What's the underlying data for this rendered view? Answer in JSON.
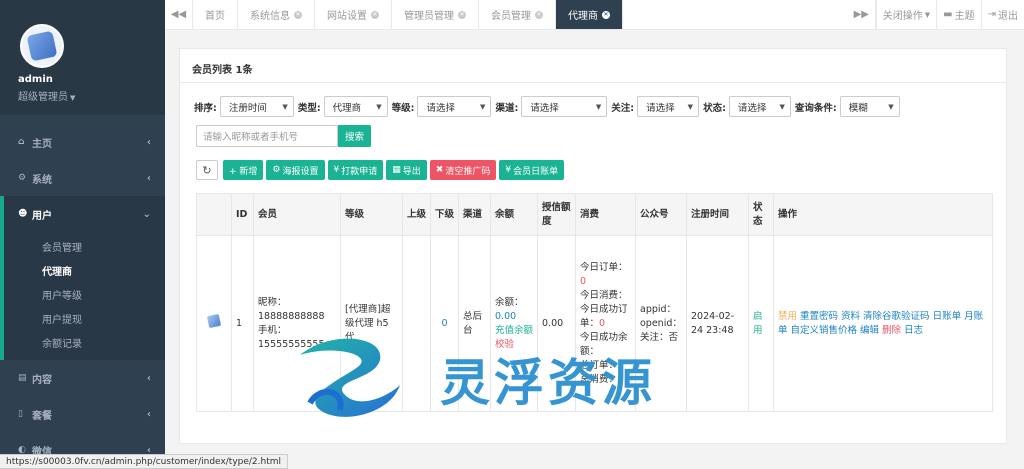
{
  "user": {
    "name": "admin",
    "role": "超级管理员"
  },
  "menu": [
    {
      "label": "主页",
      "icon": "home-icon"
    },
    {
      "label": "系统",
      "icon": "cogs-icon"
    },
    {
      "label": "用户",
      "icon": "users-icon"
    },
    {
      "label": "内容",
      "icon": "book-icon"
    },
    {
      "label": "套餐",
      "icon": "file-icon"
    },
    {
      "label": "微信",
      "icon": "wechat-icon"
    }
  ],
  "submenu": [
    "会员管理",
    "代理商",
    "用户等级",
    "用户提现",
    "余额记录"
  ],
  "tabs": [
    "首页",
    "系统信息",
    "网站设置",
    "管理员管理",
    "会员管理",
    "代理商"
  ],
  "tabbar_right": {
    "close_ops": "关闭操作",
    "theme": "主题",
    "logout": "退出"
  },
  "panel": {
    "title": "会员列表 1条"
  },
  "filters": [
    {
      "label": "排序:",
      "value": "注册时间"
    },
    {
      "label": "类型:",
      "value": "代理商"
    },
    {
      "label": "等级:",
      "value": "请选择"
    },
    {
      "label": "渠道:",
      "value": "请选择"
    },
    {
      "label": "关注:",
      "value": "请选择"
    },
    {
      "label": "状态:",
      "value": "请选择"
    },
    {
      "label": "查询条件:",
      "value": "模糊"
    }
  ],
  "search": {
    "placeholder": "请输入昵称或者手机号",
    "button": "搜索"
  },
  "toolbar": [
    "+ 新增",
    "海报设置",
    "打款申请",
    "导出",
    "清空推广码",
    "会员日账单"
  ],
  "table": {
    "headers": [
      "",
      "ID",
      "会员",
      "等级",
      "上级",
      "下级",
      "渠道",
      "余额",
      "授信额度",
      "消费",
      "公众号",
      "注册时间",
      "状态",
      "操作"
    ],
    "row": {
      "id": "1",
      "member": "昵称：18888888888 手机：15555555555",
      "level": "[代理商]超级代理 h5代",
      "upper": "",
      "lower": "0",
      "channel": "总后台",
      "balance_label": "余额：",
      "balance_value": "0.00",
      "recharge": "充值余额",
      "verify": "校验",
      "credit": "0.00",
      "consume_1": "今日订单：",
      "consume_1v": "0",
      "consume_2": "今日消费：",
      "consume_3": "今日成功订单：",
      "consume_3v": "0",
      "consume_4": "今日成功余额：",
      "consume_5": "总订单：",
      "consume_6": "总消费：",
      "mp": "appid： openid： 关注：否",
      "reg_time": "2024-02-24 23:48",
      "status": "启用",
      "actions": [
        {
          "label": "禁用",
          "color": "orange"
        },
        {
          "label": "重置密码",
          "color": "link"
        },
        {
          "label": "资料",
          "color": "link"
        },
        {
          "label": "清除谷歌验证码",
          "color": "link"
        },
        {
          "label": "日账单",
          "color": "link"
        },
        {
          "label": "月账单",
          "color": "link"
        },
        {
          "label": "自定义销售价格",
          "color": "link"
        },
        {
          "label": "编辑",
          "color": "link"
        },
        {
          "label": "删除",
          "color": "red"
        },
        {
          "label": "日志",
          "color": "link"
        }
      ]
    }
  },
  "watermark": {
    "text": "灵浮资源"
  },
  "statusbar": {
    "url": "https://s00003.0fv.cn/admin.php/customer/index/type/2.html"
  },
  "colors": {
    "sidebar": "#2f4050",
    "accent": "#1ab394",
    "danger": "#ed5565",
    "link": "#1c84c6"
  }
}
